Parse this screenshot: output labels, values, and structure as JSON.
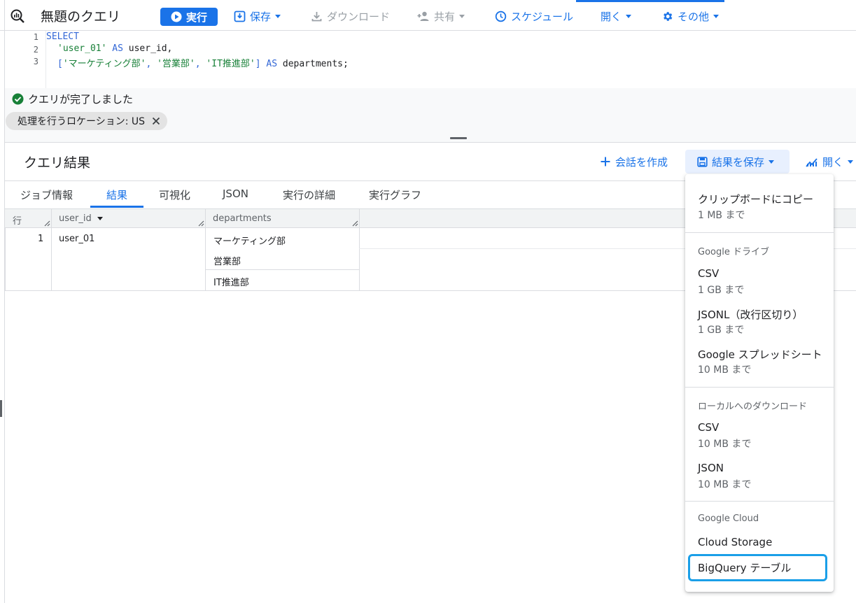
{
  "toolbar": {
    "title": "無題のクエリ",
    "run_label": "実行",
    "save_label": "保存",
    "download_label": "ダウンロード",
    "share_label": "共有",
    "schedule_label": "スケジュール",
    "open_label": "開く",
    "more_label": "その他"
  },
  "editor": {
    "line_numbers": [
      "1",
      "2",
      "3"
    ],
    "line1": "SELECT",
    "line2_str": "'user_01'",
    "line2_kw": "AS",
    "line2_id": "user_id,",
    "line3_open": "[",
    "line3_s1": "'マーケティング部'",
    "line3_c1": ",",
    "line3_s2": "'営業部'",
    "line3_c2": ",",
    "line3_s3": "'IT推進部'",
    "line3_close": "]",
    "line3_kw": "AS",
    "line3_id": "departments;"
  },
  "status": {
    "message": "クエリが完了しました",
    "location_chip": "処理を行うロケーション: US"
  },
  "results": {
    "title": "クエリ結果",
    "create_conversation": "会話を作成",
    "save_results": "結果を保存",
    "open": "開く",
    "tabs": [
      "ジョブ情報",
      "結果",
      "可視化",
      "JSON",
      "実行の詳細",
      "実行グラフ"
    ],
    "active_tab": "結果",
    "columns": [
      "行",
      "user_id",
      "departments"
    ],
    "rows": [
      {
        "row": "1",
        "user_id": "user_01",
        "departments": [
          "マーケティング部",
          "営業部",
          "IT推進部"
        ]
      }
    ]
  },
  "save_menu": {
    "clipboard_label": "クリップボードにコピー",
    "clipboard_limit": "1 MB まで",
    "drive_section": "Google ドライブ",
    "drive_csv": "CSV",
    "drive_csv_limit": "1 GB まで",
    "drive_jsonl": "JSONL（改行区切り）",
    "drive_jsonl_limit": "1 GB まで",
    "drive_sheets": "Google スプレッドシート",
    "drive_sheets_limit": "10 MB まで",
    "local_section": "ローカルへのダウンロード",
    "local_csv": "CSV",
    "local_csv_limit": "10 MB まで",
    "local_json": "JSON",
    "local_json_limit": "10 MB まで",
    "cloud_section": "Google Cloud",
    "cloud_storage": "Cloud Storage",
    "bigquery_table": "BigQuery テーブル"
  },
  "colors": {
    "accent": "#1a73e8",
    "success": "#188038",
    "focus_ring": "#1a9fe8"
  }
}
